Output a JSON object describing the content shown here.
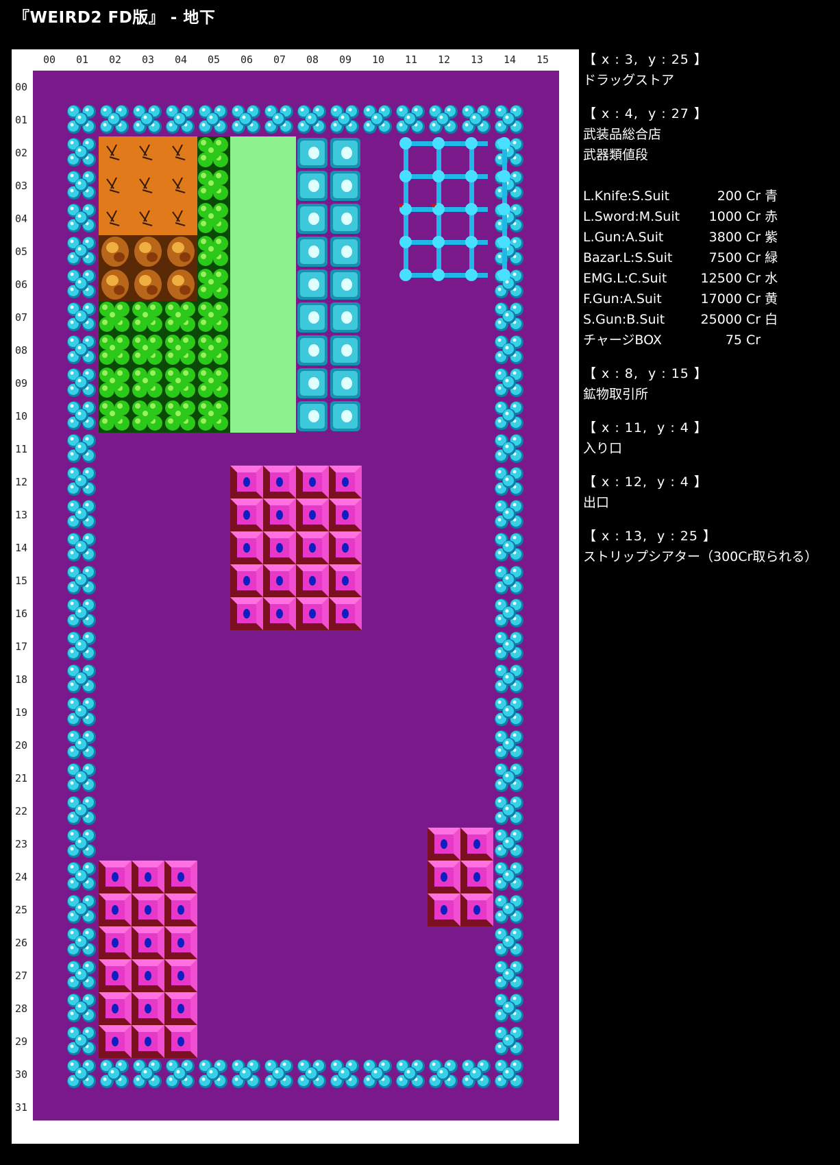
{
  "title": "『WEIRD2 FD版』 - 地下",
  "map": {
    "col_labels": [
      "00",
      "01",
      "02",
      "03",
      "04",
      "05",
      "06",
      "07",
      "08",
      "09",
      "10",
      "11",
      "12",
      "13",
      "14",
      "15"
    ],
    "row_labels": [
      "00",
      "01",
      "02",
      "03",
      "04",
      "05",
      "06",
      "07",
      "08",
      "09",
      "10",
      "11",
      "12",
      "13",
      "14",
      "15",
      "16",
      "17",
      "18",
      "19",
      "20",
      "21",
      "22",
      "23",
      "24",
      "25",
      "26",
      "27",
      "28",
      "29",
      "30",
      "31"
    ],
    "colors": {
      "floor": "#7a1a8a",
      "wall": "#36d0e8",
      "wall_dark": "#0f7fa8",
      "dirt": "#e07a1a",
      "rock": "#b8661a",
      "bush": "#2cc81a",
      "path": "#8cf08c",
      "ice": "#3ec8dc",
      "building": "#e838c8",
      "building_edge": "#7a1020",
      "lattice": "#20b8e8",
      "marker": "#c01818"
    },
    "tiles": {
      "walls": "ring rows 01 & 30, cols 01 & 14",
      "dirt": "x02-04 y02-04",
      "rock": "x02-04 y05-06",
      "bush": "x02-04 y07-10, x05 y02-10",
      "path": "x06-07 y02-10",
      "ice": "x08-09 y02-10",
      "lattice": "x11-13 y02-06",
      "buildings": "x06-09 y12-16, x02-04 y24-29, x12-13 y23-25"
    }
  },
  "notes": [
    {
      "coord": "【 x : 3,  y : 25 】",
      "lines": [
        "ドラッグストア"
      ]
    },
    {
      "coord": "【 x : 4,  y : 27 】",
      "lines": [
        "武装品総合店",
        "武器類値段"
      ],
      "prices": [
        {
          "item": "L.Knife:S.Suit",
          "price": "200",
          "unit": "Cr",
          "color": "青"
        },
        {
          "item": "L.Sword:M.Suit",
          "price": "1000",
          "unit": "Cr",
          "color": "赤"
        },
        {
          "item": "L.Gun:A.Suit",
          "price": "3800",
          "unit": "Cr",
          "color": "紫"
        },
        {
          "item": "Bazar.L:S.Suit",
          "price": "7500",
          "unit": "Cr",
          "color": "緑"
        },
        {
          "item": "EMG.L:C.Suit",
          "price": "12500",
          "unit": "Cr",
          "color": "水"
        },
        {
          "item": "F.Gun:A.Suit",
          "price": "17000",
          "unit": "Cr",
          "color": "黄"
        },
        {
          "item": "S.Gun:B.Suit",
          "price": "25000",
          "unit": "Cr",
          "color": "白"
        },
        {
          "item": "チャージBOX",
          "price": "75",
          "unit": "Cr",
          "color": ""
        }
      ]
    },
    {
      "coord": "【 x : 8,  y : 15 】",
      "lines": [
        "鉱物取引所"
      ]
    },
    {
      "coord": "【 x : 11,  y : 4 】",
      "lines": [
        "入り口"
      ]
    },
    {
      "coord": "【 x : 12,  y : 4 】",
      "lines": [
        "出口"
      ]
    },
    {
      "coord": "【 x : 13,  y : 25 】",
      "lines": [
        "ストリップシアター（300Cr取られる）"
      ]
    }
  ]
}
